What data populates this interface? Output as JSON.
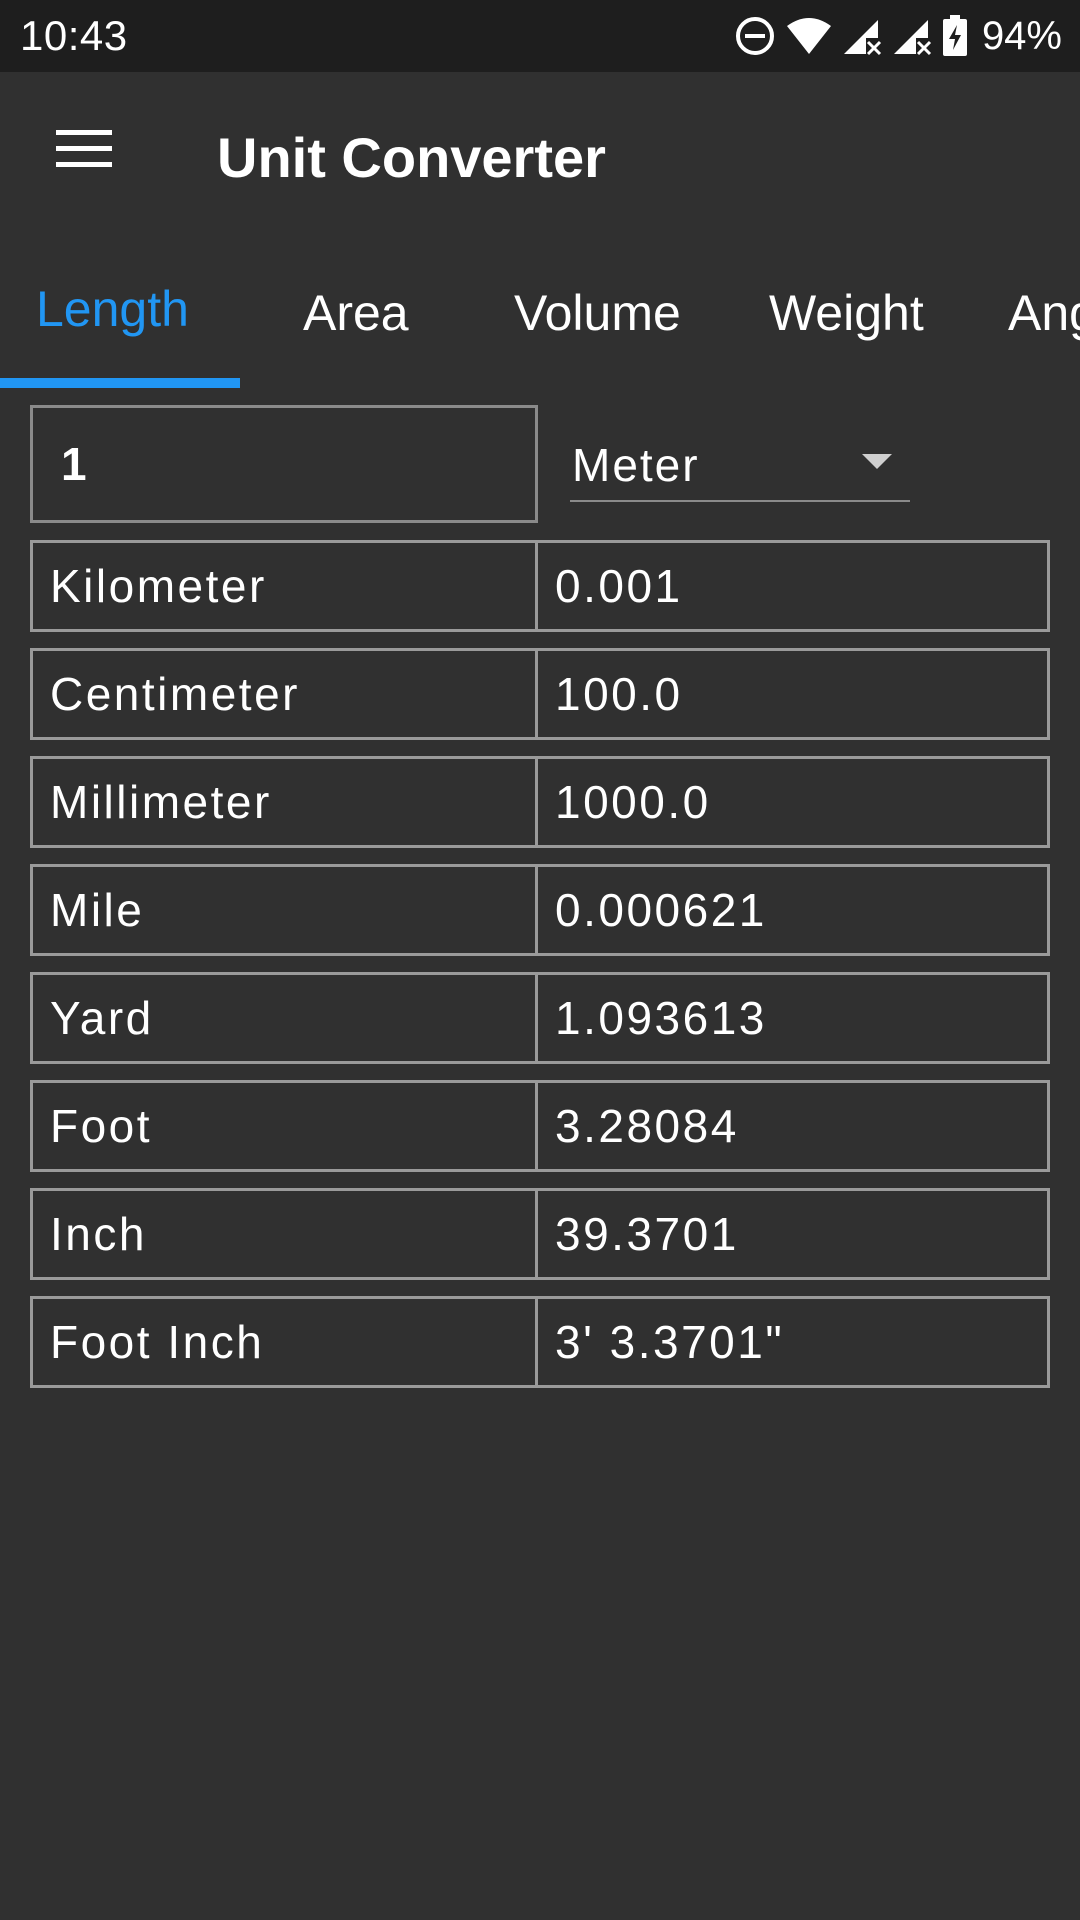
{
  "status_bar": {
    "time": "10:43",
    "battery": "94%",
    "icons": [
      "do-not-disturb-icon",
      "wifi-icon",
      "signal-no-service-icon",
      "signal-no-service-icon",
      "battery-charging-icon"
    ]
  },
  "app_bar": {
    "menu_icon": "hamburger-menu-icon",
    "title": "Unit Converter"
  },
  "tabs": [
    {
      "label": "Length",
      "active": true
    },
    {
      "label": "Area",
      "active": false
    },
    {
      "label": "Volume",
      "active": false
    },
    {
      "label": "Weight",
      "active": false
    },
    {
      "label": "Ang",
      "active": false
    }
  ],
  "colors": {
    "accent": "#2196f3",
    "background": "#303030",
    "status_bar": "#1e1e1e",
    "border": "#9a9a9a"
  },
  "converter": {
    "input_value": "1",
    "selected_unit": "Meter",
    "dropdown_icon": "triangle-down-icon"
  },
  "results": [
    {
      "unit": "Kilometer",
      "value": "0.001"
    },
    {
      "unit": "Centimeter",
      "value": "100.0"
    },
    {
      "unit": "Millimeter",
      "value": "1000.0"
    },
    {
      "unit": "Mile",
      "value": "0.000621"
    },
    {
      "unit": "Yard",
      "value": "1.093613"
    },
    {
      "unit": "Foot",
      "value": "3.28084"
    },
    {
      "unit": "Inch",
      "value": "39.3701"
    },
    {
      "unit": "Foot Inch",
      "value": "3' 3.3701\""
    }
  ]
}
